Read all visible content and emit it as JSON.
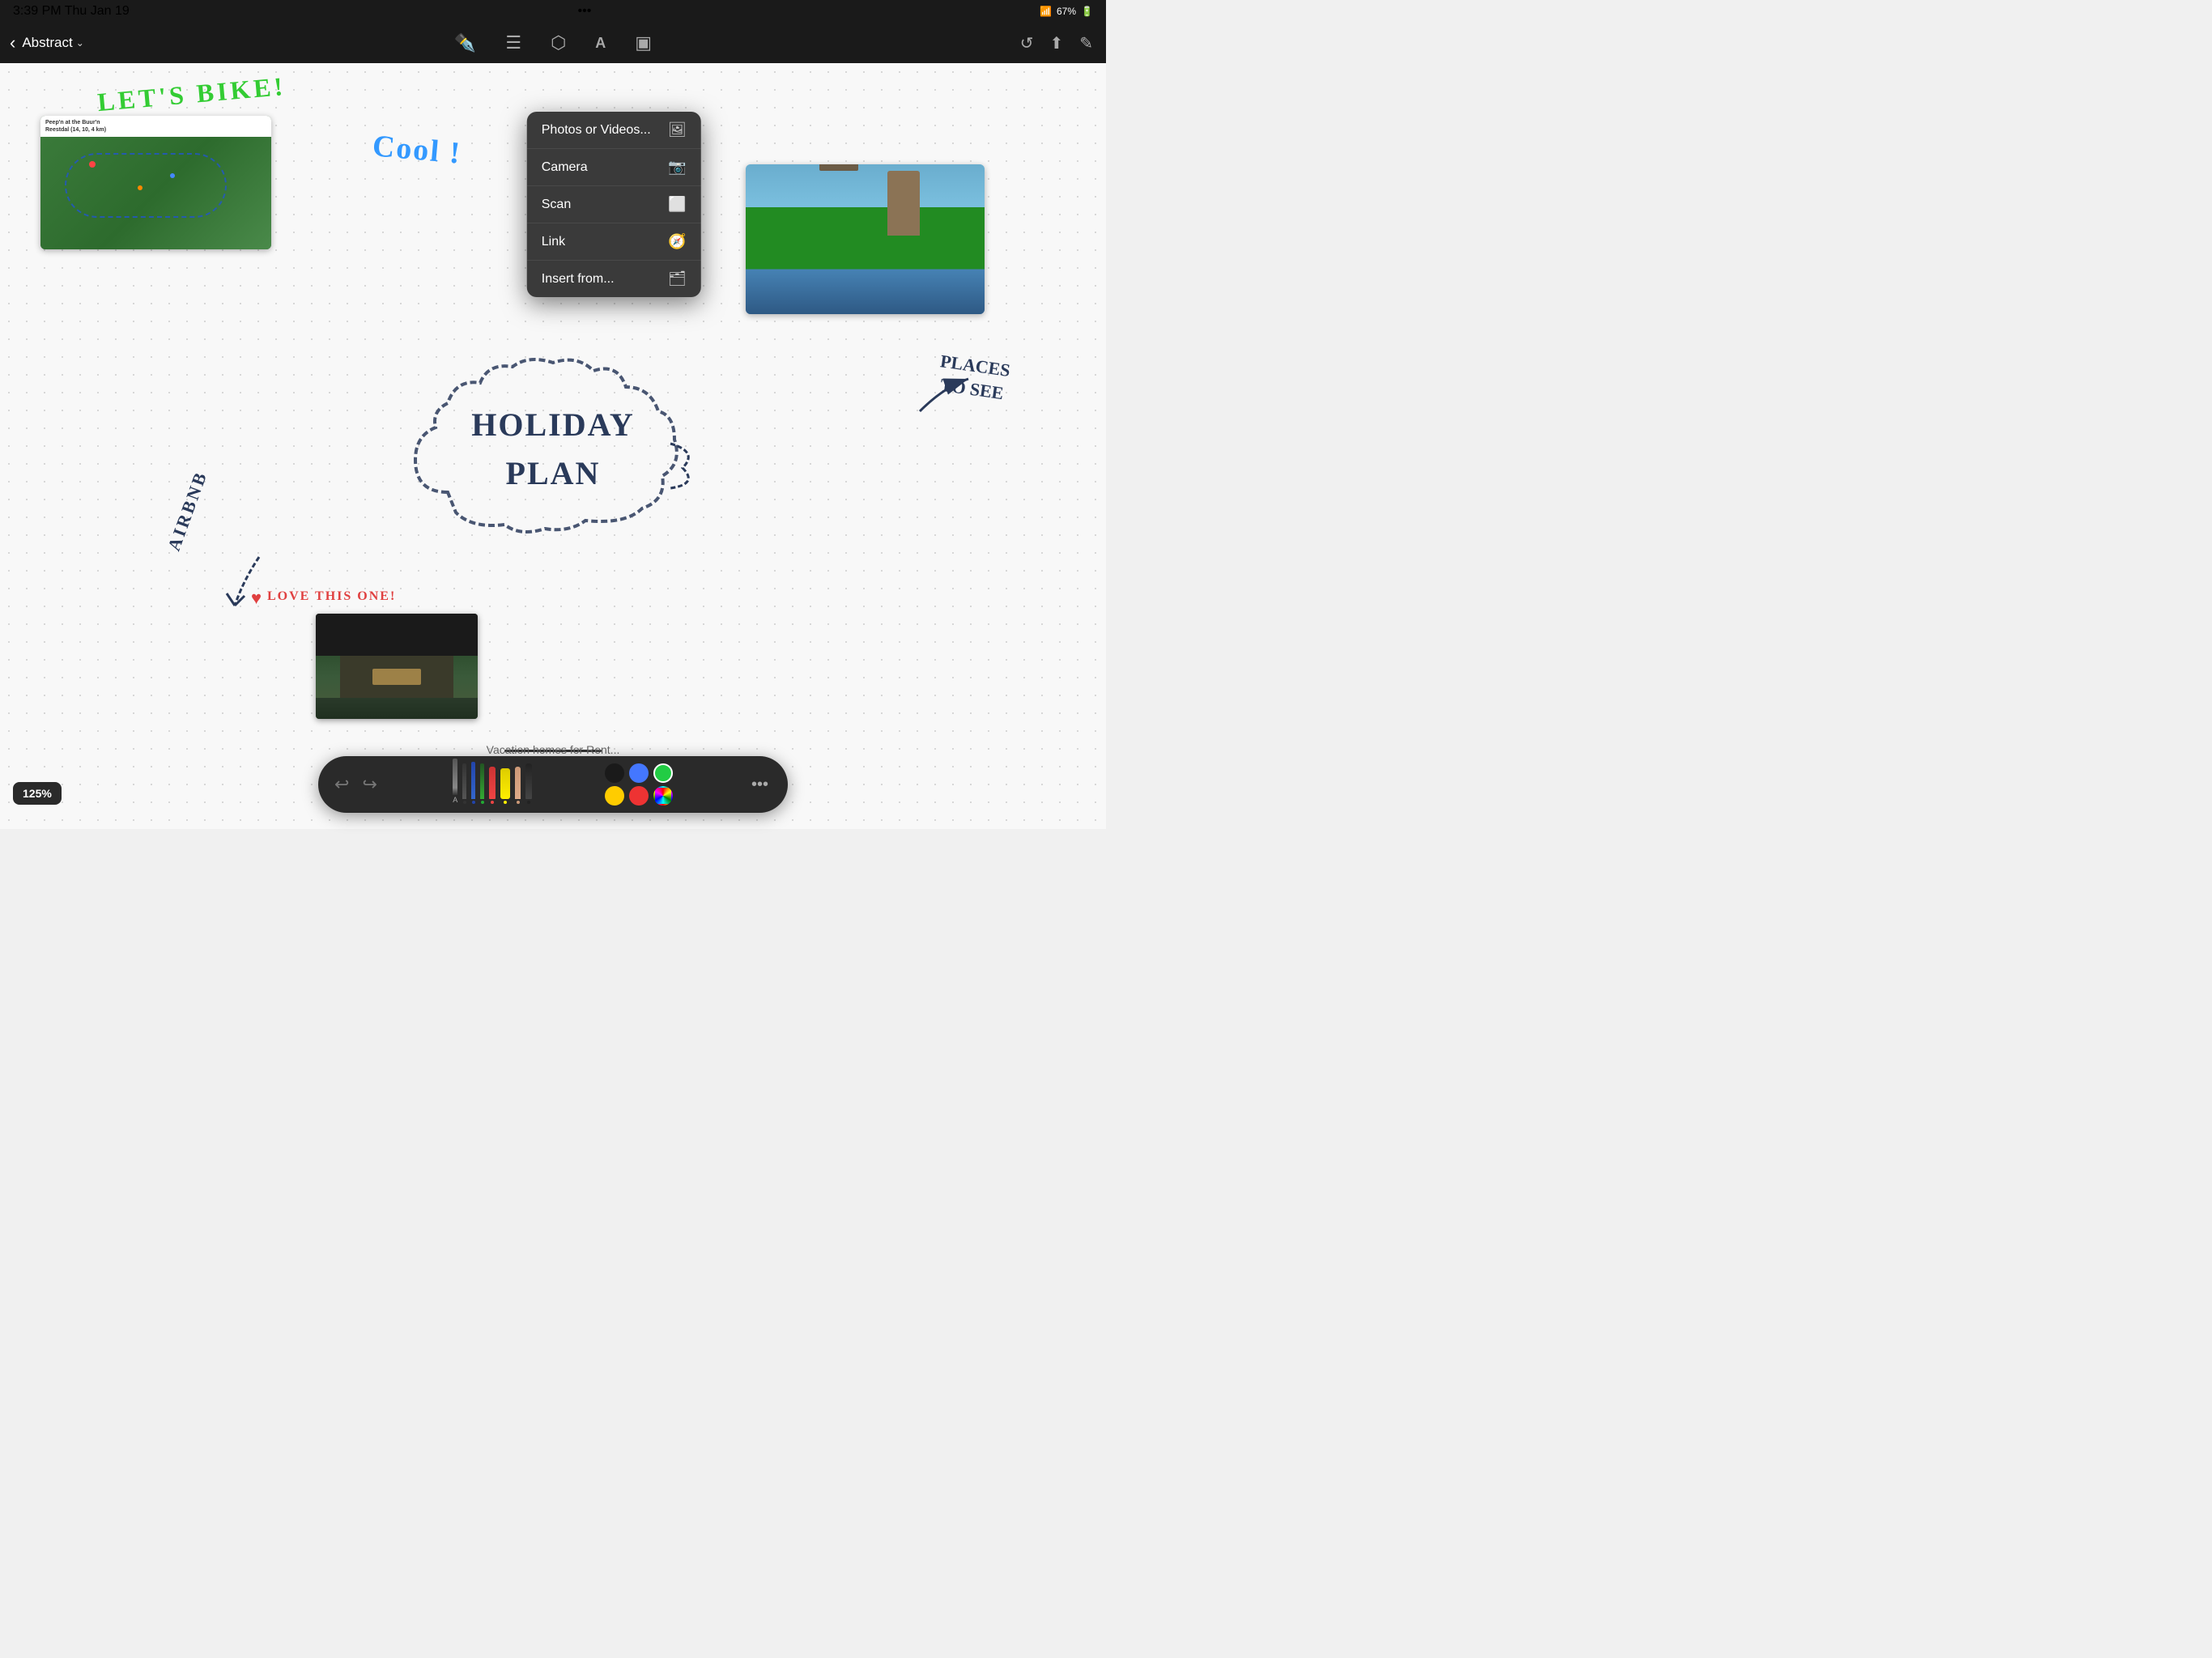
{
  "statusBar": {
    "time": "3:39 PM  Thu Jan 19",
    "dots": "•••",
    "wifi": "WiFi",
    "battery": "67%"
  },
  "navBar": {
    "backLabel": "‹",
    "docTitle": "Abstract",
    "chevron": "⌄",
    "tools": [
      {
        "id": "pen",
        "icon": "✒",
        "active": true
      },
      {
        "id": "text",
        "icon": "≡",
        "active": false
      },
      {
        "id": "shape",
        "icon": "⬡",
        "active": false
      },
      {
        "id": "font",
        "icon": "A",
        "active": false
      },
      {
        "id": "media",
        "icon": "⬛",
        "active": false
      }
    ],
    "rightIcons": [
      {
        "id": "history",
        "icon": "↺"
      },
      {
        "id": "share",
        "icon": "⬆"
      },
      {
        "id": "edit",
        "icon": "✎"
      }
    ]
  },
  "dropdown": {
    "items": [
      {
        "id": "photos",
        "label": "Photos or Videos...",
        "icon": "🖼"
      },
      {
        "id": "camera",
        "label": "Camera",
        "icon": "📷"
      },
      {
        "id": "scan",
        "label": "Scan",
        "icon": "⬜"
      },
      {
        "id": "link",
        "label": "Link",
        "icon": "🧭"
      },
      {
        "id": "insert",
        "label": "Insert from...",
        "icon": "🗂"
      }
    ]
  },
  "canvas": {
    "letsBike": "LET'S BIKE!",
    "coolText": "Cool !",
    "holidayPlan": "HOLIDAY PLAN",
    "placesToSee": "PLACES\nTO SEE",
    "airbnb": "AIRBNB",
    "loveText": "LOVE THIS ONE!",
    "vacationText": "Vacation homes for Rent..."
  },
  "bottomToolbar": {
    "undo": "↩",
    "redo": "↪",
    "moreIcon": "•••",
    "colors": {
      "row1": [
        "#1a1a1a",
        "#4477ff",
        "#22cc44"
      ],
      "row2": [
        "#ffcc00",
        "#ee3333",
        "multicolor"
      ]
    },
    "zoom": "125%"
  }
}
